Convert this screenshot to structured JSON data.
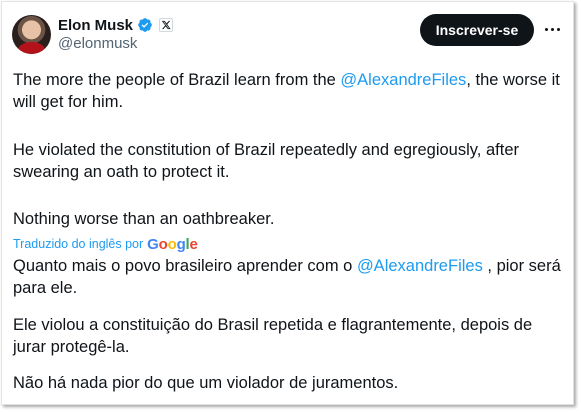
{
  "author": {
    "name": "Elon Musk",
    "handle": "@elonmusk",
    "verified_icon": "verified-badge-icon",
    "affiliation_icon": "x-logo-icon"
  },
  "actions": {
    "subscribe_label": "Inscrever-se",
    "more_icon": "more-dots-icon"
  },
  "original": {
    "p1_before": "The more the people of Brazil learn from the ",
    "p1_mention": "@AlexandreFiles",
    "p1_after": ", the worse it will get for him.",
    "p2": "He violated the constitution of Brazil repeatedly and egregiously, after swearing an oath to protect it.",
    "p3": "Nothing worse than an oathbreaker."
  },
  "translation_notice": {
    "label": "Traduzido do inglês por",
    "provider": "Google"
  },
  "translated": {
    "p1_before": "Quanto mais o povo brasileiro aprender com o ",
    "p1_mention": "@AlexandreFiles",
    "p1_after": " , pior será para ele.",
    "p2": "Ele violou a constituição do Brasil repetida e flagrantemente, depois de jurar protegê-la.",
    "p3": "Não há nada pior do que um violador de juramentos."
  },
  "colors": {
    "link": "#1d9bf0",
    "text": "#0f1419",
    "secondary": "#536471",
    "button_bg": "#0f1419"
  }
}
